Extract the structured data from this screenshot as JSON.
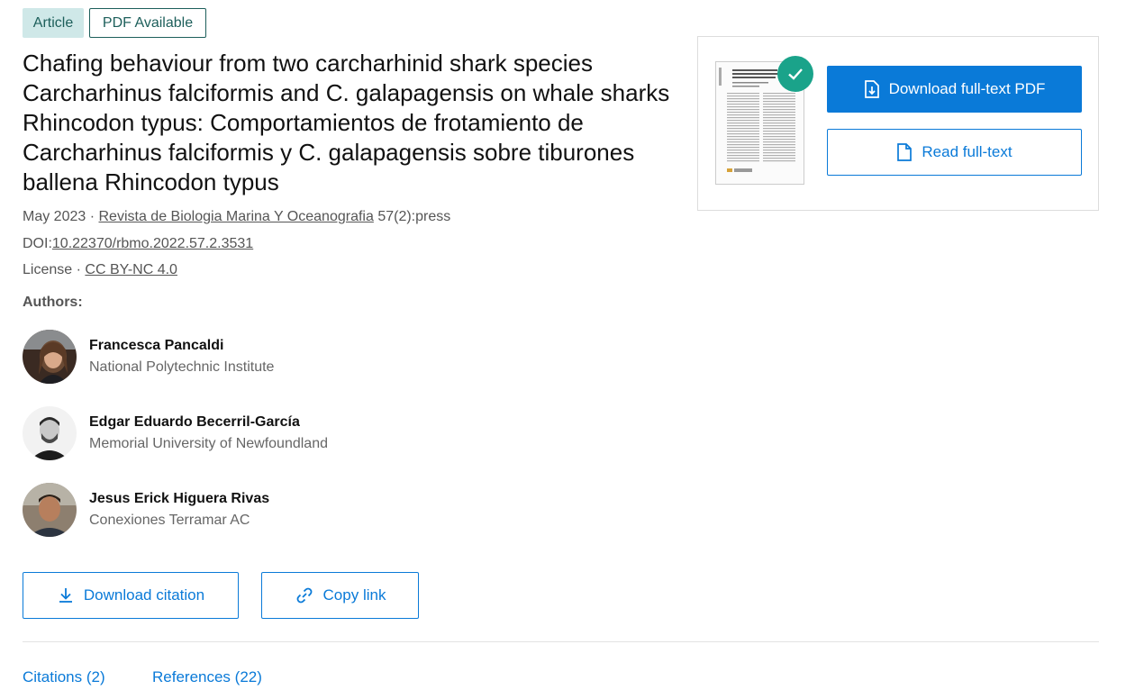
{
  "badges": {
    "type": "Article",
    "availability": "PDF Available"
  },
  "title": "Chafing behaviour from two carcharhinid shark species Carcharhinus falciformis and C. galapagensis on whale sharks Rhincodon typus: Comportamientos de frotamiento de Carcharhinus falciformis y C. galapagensis sobre tiburones ballena Rhincodon typus",
  "meta": {
    "date": "May 2023",
    "separator": "·",
    "journal": "Revista de Biologia Marina Y Oceanografia",
    "volume": "57(2):press",
    "doi_label": "DOI:",
    "doi": "10.22370/rbmo.2022.57.2.3531",
    "license_label": "License",
    "license": "CC BY-NC 4.0"
  },
  "authors_heading": "Authors:",
  "authors": [
    {
      "name": "Francesca Pancaldi",
      "institution": "National Polytechnic Institute"
    },
    {
      "name": "Edgar Eduardo Becerril-García",
      "institution": "Memorial University of Newfoundland"
    },
    {
      "name": "Jesus Erick Higuera Rivas",
      "institution": "Conexiones Terramar AC"
    }
  ],
  "actions": {
    "download_citation": "Download citation",
    "copy_link": "Copy link"
  },
  "tabs": {
    "citations": "Citations (2)",
    "references": "References (22)"
  },
  "card": {
    "download_pdf": "Download full-text PDF",
    "read_fulltext": "Read full-text"
  },
  "icons": {
    "download": "download-icon",
    "link": "link-icon",
    "file_download": "file-download-icon",
    "file": "file-icon",
    "check": "check-icon"
  },
  "colors": {
    "accent": "#0a7ad8",
    "badge_bg": "#cfe8e8",
    "badge_text": "#1d5f5b",
    "check": "#1aa38a"
  }
}
